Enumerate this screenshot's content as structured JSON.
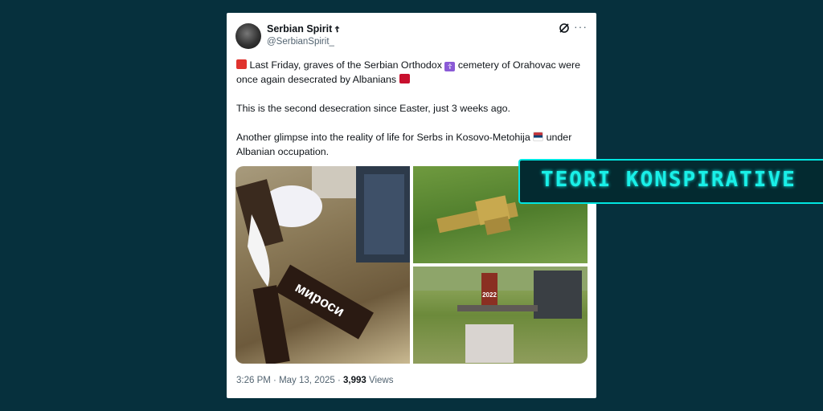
{
  "tweet": {
    "display_name": "Serbian Spirit",
    "verified_badge": "☦",
    "handle": "@SerbianSpirit_",
    "more_label": "···",
    "para1_a": "Last Friday, graves of the Serbian Orthodox",
    "para1_b": "cemetery of Orahovac",
    "para1_c": "were once again desecrated by Albanians",
    "para2": "This is the second desecration since Easter, just 3 weeks ago.",
    "para3_a": "Another glimpse into the reality of life for Serbs in Kosovo-Metohija",
    "para3_b": "under Albanian occupation.",
    "time": "3:26 PM",
    "sep": "·",
    "date": "May 13, 2025",
    "views_count": "3,993",
    "views_label": "Views"
  },
  "media": {
    "cross_inscription": "мироси",
    "marker_year": "2022"
  },
  "banner": {
    "text": "TEORI KONSPIRATIVE"
  },
  "colors": {
    "background": "#06303d",
    "banner_accent": "#19f0e8"
  }
}
